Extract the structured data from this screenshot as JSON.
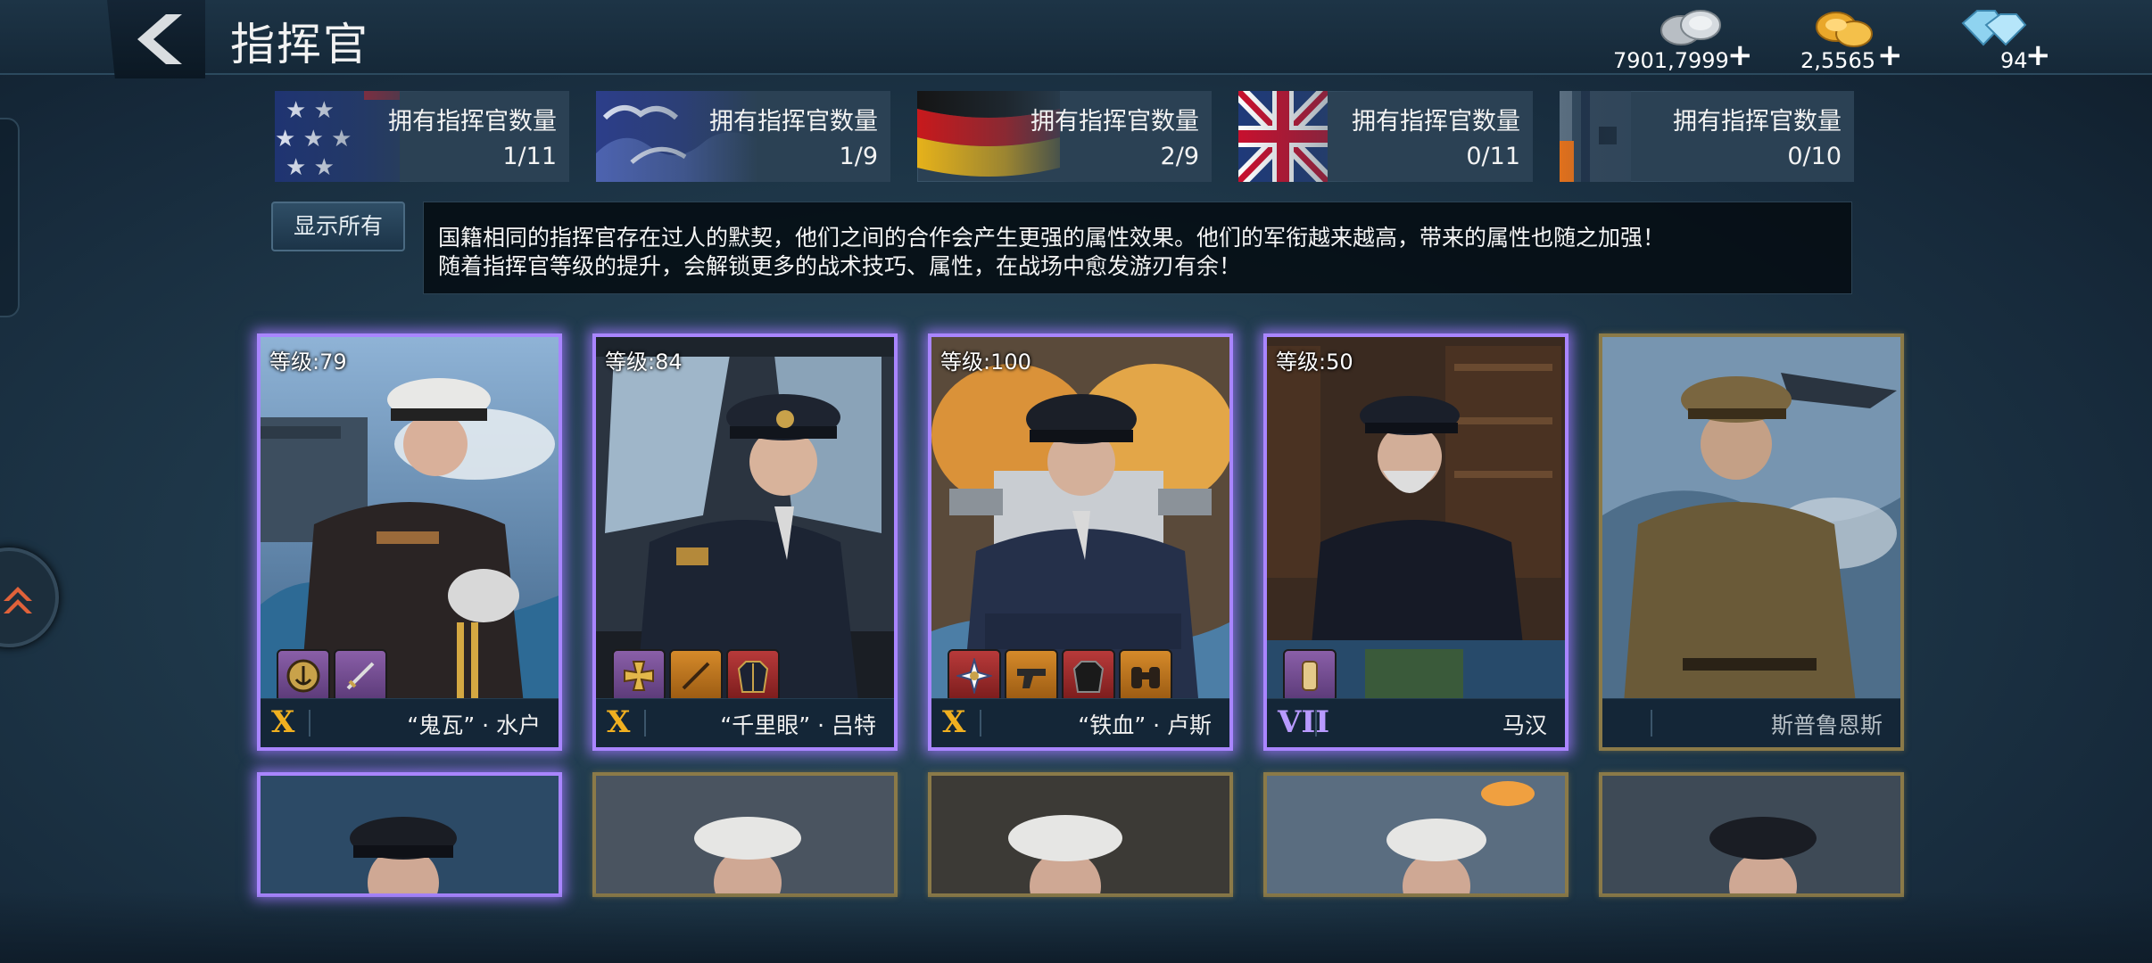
{
  "header": {
    "title": "指挥官",
    "currencies": [
      {
        "icon": "silver-coins-icon",
        "amount": "7901,7999"
      },
      {
        "icon": "gold-coins-icon",
        "amount": "2,5565"
      },
      {
        "icon": "diamond-icon",
        "amount": "94"
      }
    ],
    "plus": "+"
  },
  "nations": [
    {
      "flag": "usa-flag",
      "label": "拥有指挥官数量",
      "count": "1/11"
    },
    {
      "flag": "japan-flag",
      "label": "拥有指挥官数量",
      "count": "1/9"
    },
    {
      "flag": "germany-flag",
      "label": "拥有指挥官数量",
      "count": "2/9"
    },
    {
      "flag": "uk-flag",
      "label": "拥有指挥官数量",
      "count": "0/11"
    },
    {
      "flag": "other-flag",
      "label": "拥有指挥官数量",
      "count": "0/10"
    }
  ],
  "filter": {
    "show_all": "显示所有"
  },
  "description": {
    "line1": "国籍相同的指挥官存在过人的默契，他们之间的合作会产生更强的属性效果。他们的军衔越来越高，带来的属性也随之加强！",
    "line2": "随着指挥官等级的提升，会解锁更多的战术技巧、属性，在战场中愈发游刃有余！"
  },
  "commanders": [
    {
      "level": "等级:79",
      "rank": "X",
      "name": "“鬼瓦” · 水户",
      "frame": "purple",
      "equipment": [
        "anchor-medal-icon",
        "sword-icon"
      ]
    },
    {
      "level": "等级:84",
      "rank": "X",
      "name": "“千里眼” · 吕特",
      "frame": "purple",
      "equipment": [
        "iron-cross-icon",
        "sword-icon",
        "coat-icon"
      ]
    },
    {
      "level": "等级:100",
      "rank": "X",
      "name": "“铁血” · 卢斯",
      "frame": "purple",
      "equipment": [
        "cross-medal-icon",
        "pistol-icon",
        "coat-icon",
        "binoculars-icon"
      ]
    },
    {
      "level": "等级:50",
      "rank": "VII",
      "name": "马汉",
      "frame": "purple",
      "equipment": [
        "scroll-icon"
      ]
    },
    {
      "level": "",
      "rank": "",
      "name": "斯普鲁恩斯",
      "frame": "gold",
      "equipment": []
    }
  ],
  "colors": {
    "rank_gold": "#f0b020",
    "rank_purple": "#b89aff",
    "frame_purple": "#a985ff",
    "frame_gold": "#8b7a48"
  }
}
